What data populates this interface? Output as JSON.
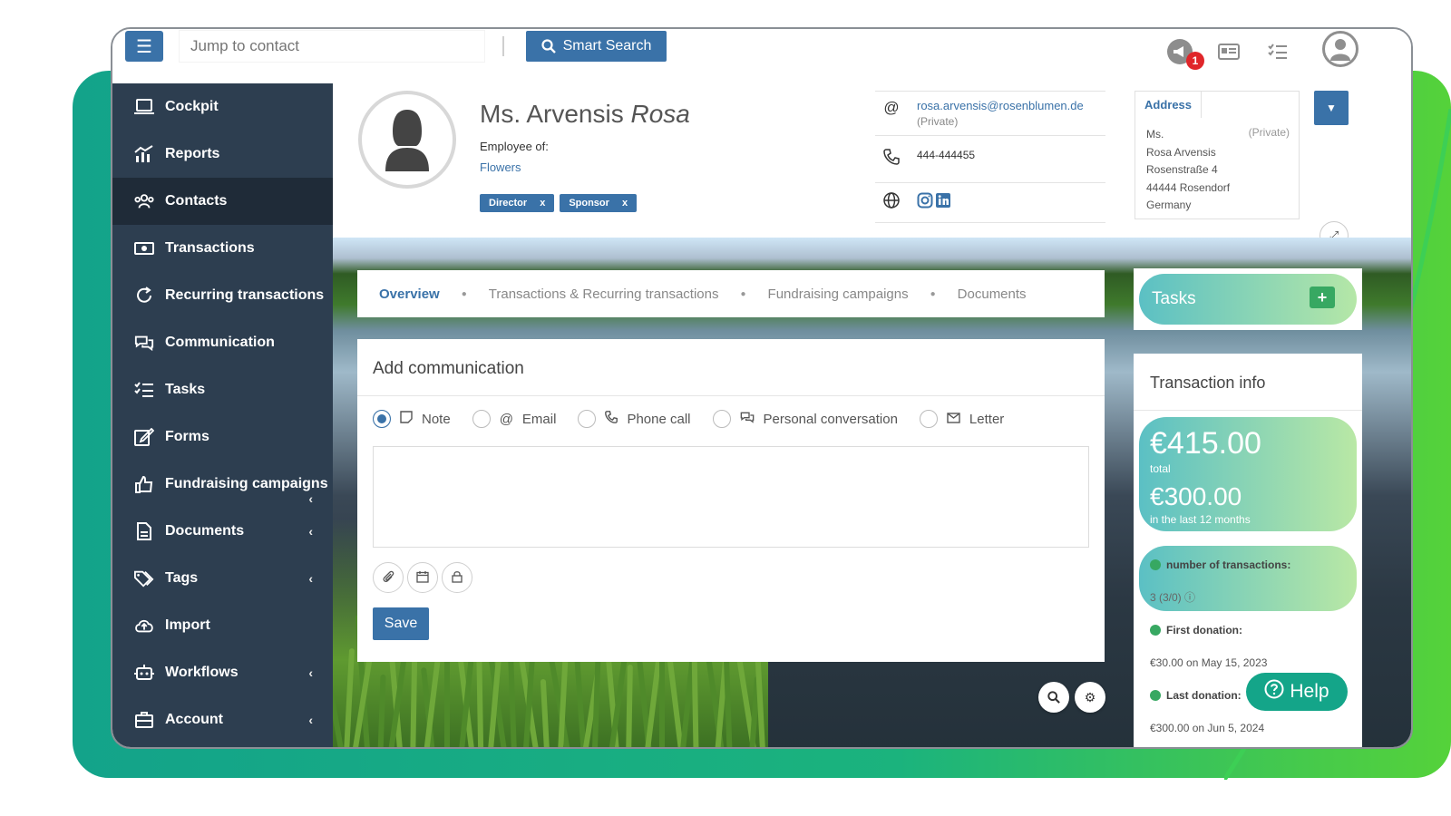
{
  "topbar": {
    "search_placeholder": "Jump to contact",
    "smart_search_label": "Smart Search",
    "notification_count": "1"
  },
  "sidebar": {
    "items": [
      {
        "label": "Cockpit",
        "icon": "laptop-icon"
      },
      {
        "label": "Reports",
        "icon": "chart-icon"
      },
      {
        "label": "Contacts",
        "icon": "users-icon",
        "active": true
      },
      {
        "label": "Transactions",
        "icon": "money-icon"
      },
      {
        "label": "Recurring transactions",
        "icon": "recurring-icon"
      },
      {
        "label": "Communication",
        "icon": "chat-icon"
      },
      {
        "label": "Tasks",
        "icon": "tasks-icon"
      },
      {
        "label": "Forms",
        "icon": "edit-icon"
      },
      {
        "label": "Fundraising campaigns",
        "icon": "thumbs-up-icon"
      },
      {
        "label": "Documents",
        "icon": "document-icon"
      },
      {
        "label": "Tags",
        "icon": "tags-icon"
      },
      {
        "label": "Import",
        "icon": "cloud-upload-icon"
      },
      {
        "label": "Workflows",
        "icon": "robot-icon"
      },
      {
        "label": "Account",
        "icon": "briefcase-icon"
      }
    ]
  },
  "contact": {
    "salutation": "Ms. Arvensis",
    "first_name": "Rosa",
    "employee_label": "Employee of:",
    "employer": "Flowers",
    "tags": [
      "Director",
      "Sponsor"
    ],
    "tag_remove": "x",
    "email": "rosa.arvensis@rosenblumen.de",
    "email_type": "(Private)",
    "phone": "444-444455"
  },
  "address": {
    "tab_label": "Address",
    "type": "(Private)",
    "lines": [
      "Ms.",
      "Rosa Arvensis",
      "Rosenstraße 4",
      "44444 Rosendorf",
      "Germany"
    ]
  },
  "tabs": [
    "Overview",
    "Transactions & Recurring transactions",
    "Fundraising campaigns",
    "Documents"
  ],
  "communication": {
    "title": "Add communication",
    "options": [
      "Note",
      "Email",
      "Phone call",
      "Personal conversation",
      "Letter"
    ],
    "selected": "Note",
    "save_label": "Save"
  },
  "tasks": {
    "title": "Tasks",
    "add": "+"
  },
  "transaction_info": {
    "title": "Transaction info",
    "total_amount": "€415.00",
    "total_label": "total",
    "last12_amount": "€300.00",
    "last12_label": "in the last 12 months",
    "count_label": "number of transactions:",
    "count_value": "3 (3/0)",
    "first_label": "First donation:",
    "first_value": "€30.00 on May 15, 2023",
    "last_label": "Last donation:",
    "last_value": "€300.00 on Jun 5, 2024"
  },
  "help": {
    "label": "Help"
  },
  "colors": {
    "primary": "#3a72a8",
    "sidebar": "#2d3e50",
    "accent_green": "#14a589"
  }
}
